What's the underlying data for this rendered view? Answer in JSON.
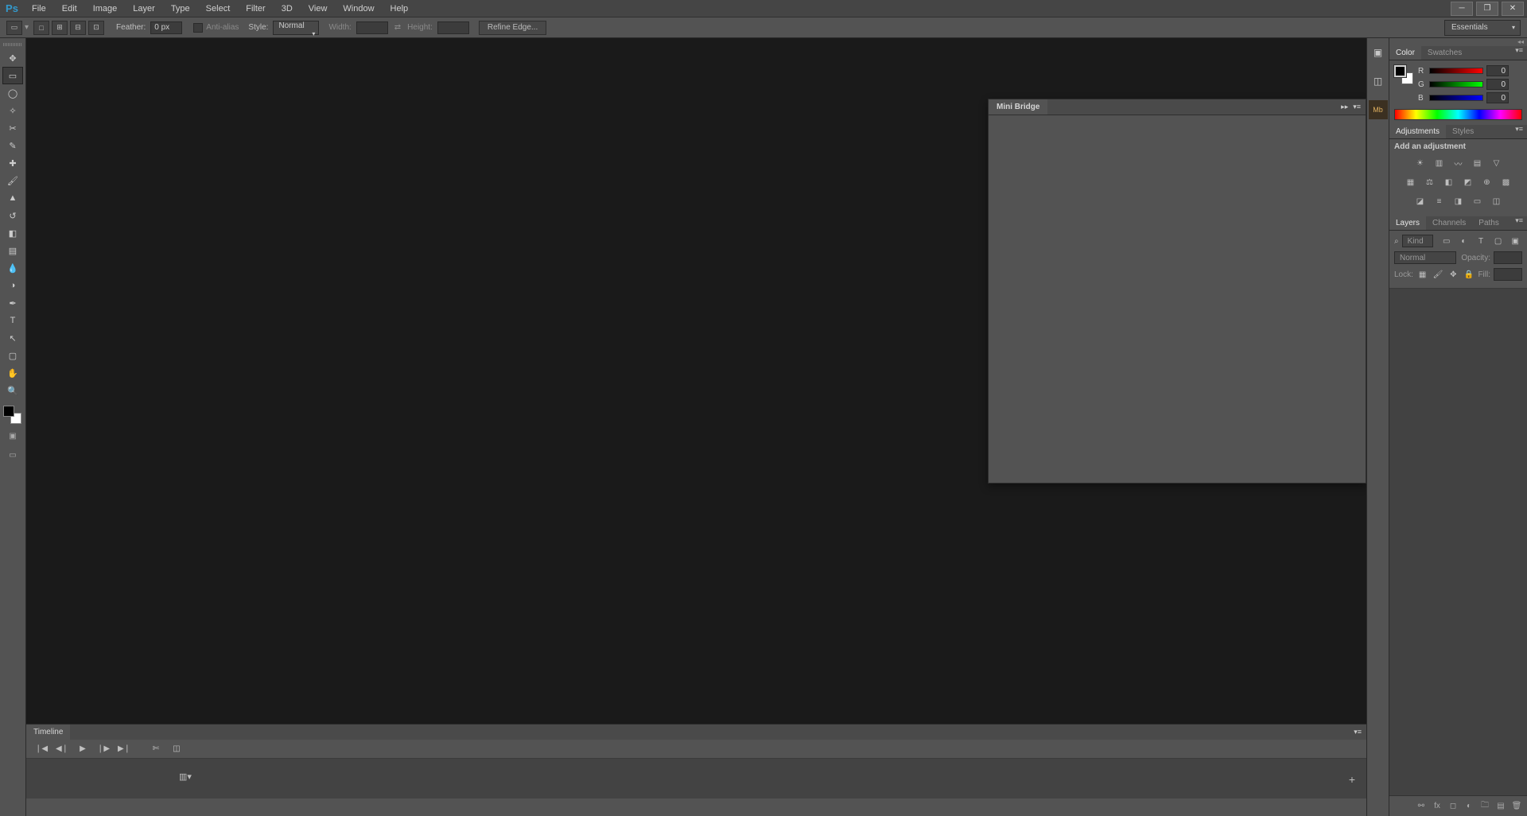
{
  "app": {
    "logo": "Ps"
  },
  "menus": [
    "File",
    "Edit",
    "Image",
    "Layer",
    "Type",
    "Select",
    "Filter",
    "3D",
    "View",
    "Window",
    "Help"
  ],
  "options": {
    "feather_label": "Feather:",
    "feather_value": "0 px",
    "anti_alias": "Anti-alias",
    "style_label": "Style:",
    "style_value": "Normal",
    "width_label": "Width:",
    "height_label": "Height:",
    "refine": "Refine Edge..."
  },
  "workspace": "Essentials",
  "mini_bridge": {
    "title": "Mini Bridge"
  },
  "timeline": {
    "title": "Timeline"
  },
  "color": {
    "tab1": "Color",
    "tab2": "Swatches",
    "r_label": "R",
    "r_val": "0",
    "g_label": "G",
    "g_val": "0",
    "b_label": "B",
    "b_val": "0"
  },
  "adjustments": {
    "tab1": "Adjustments",
    "tab2": "Styles",
    "add": "Add an adjustment"
  },
  "layers": {
    "tab1": "Layers",
    "tab2": "Channels",
    "tab3": "Paths",
    "kind": "Kind",
    "blend": "Normal",
    "opacity": "Opacity:",
    "lock": "Lock:",
    "fill": "Fill:"
  }
}
